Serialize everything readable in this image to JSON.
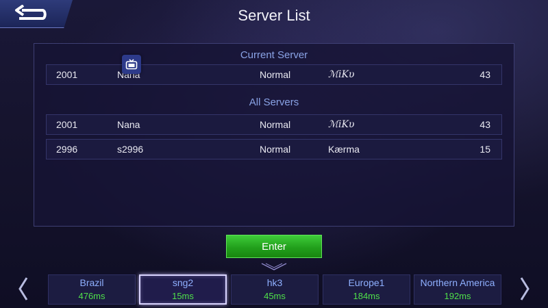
{
  "header": {
    "title": "Server List"
  },
  "current_server": {
    "section_title": "Current Server",
    "row": {
      "id": "2001",
      "name": "Nana",
      "status": "Normal",
      "owner": "ℳiKυ",
      "level": "43"
    }
  },
  "all_servers": {
    "section_title": "All Servers",
    "rows": [
      {
        "id": "2001",
        "name": "Nana",
        "status": "Normal",
        "owner": "ℳiKυ",
        "level": "43"
      },
      {
        "id": "2996",
        "name": "s2996",
        "status": "Normal",
        "owner": "Kærma",
        "level": "15"
      }
    ]
  },
  "enter_button": {
    "label": "Enter"
  },
  "regions": [
    {
      "name": "Brazil",
      "ping": "476ms",
      "selected": false
    },
    {
      "name": "sng2",
      "ping": "15ms",
      "selected": true
    },
    {
      "name": "hk3",
      "ping": "45ms",
      "selected": false
    },
    {
      "name": "Europe1",
      "ping": "184ms",
      "selected": false
    },
    {
      "name": "Northern America",
      "ping": "192ms",
      "selected": false
    }
  ],
  "colors": {
    "accent_title": "#8aa3e6",
    "ping_green": "#4fe04a",
    "enter_green": "#22a01c"
  },
  "icons": {
    "back": "back-arrow-icon",
    "tv": "tv-icon",
    "left": "chevron-left-icon",
    "right": "chevron-right-icon"
  }
}
